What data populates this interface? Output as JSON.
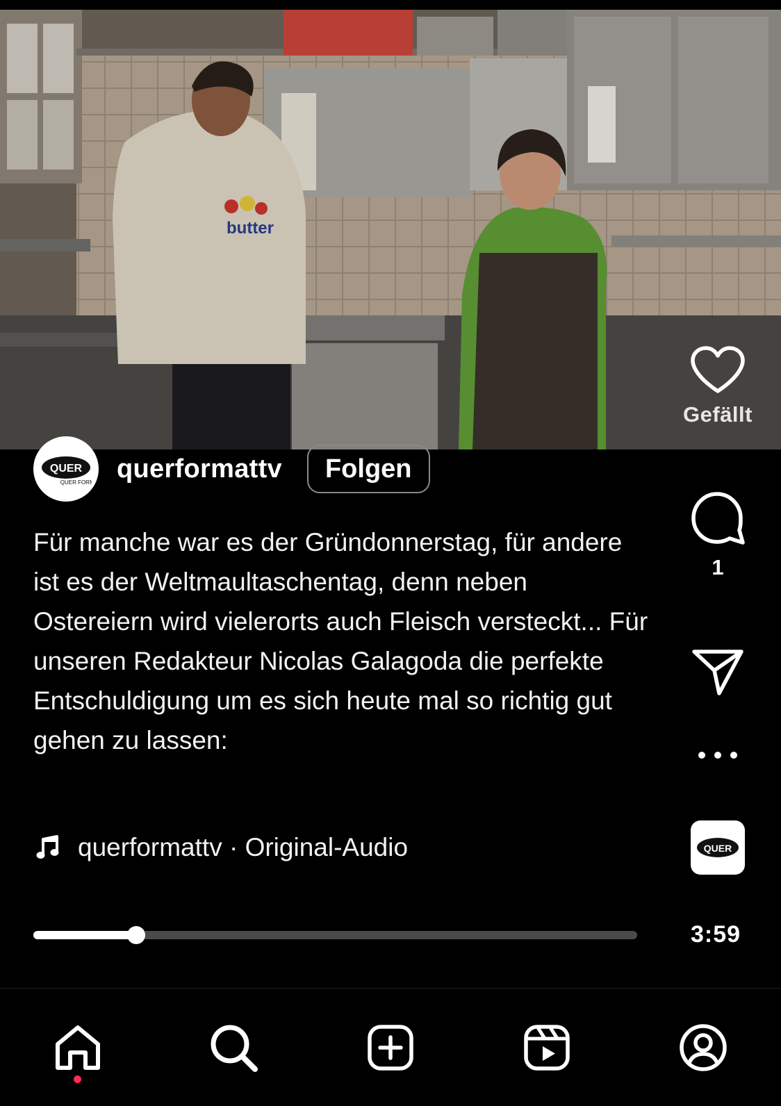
{
  "post": {
    "username": "querformattv",
    "follow_label": "Folgen",
    "caption": "Für manche war es der Gründonnerstag, für andere ist es der Weltmaultaschentag, denn neben Ostereiern wird vielerorts auch Fleisch versteckt... Für unseren Redakteur Nicolas Galagoda die perfekte Entschuldigung um es sich heute mal so richtig gut gehen zu lassen:",
    "audio_label": "querformattv · Original-Audio",
    "avatar_logo_text": "QUER FORMAT",
    "video_hoodie_text": "butter"
  },
  "actions": {
    "like_label": "Gefällt",
    "comment_count": "1",
    "like_icon": "heart-icon",
    "comment_icon": "speech-bubble-icon",
    "share_icon": "paper-plane-icon",
    "more_icon": "more-horizontal-icon",
    "audio_icon": "music-note-icon"
  },
  "player": {
    "progress_fraction": 0.17,
    "duration": "3:59"
  },
  "nav": {
    "items": [
      "home-icon",
      "search-icon",
      "create-icon",
      "reels-icon",
      "profile-icon"
    ],
    "active": "home-icon",
    "indicator_color": "#ff2a55"
  }
}
